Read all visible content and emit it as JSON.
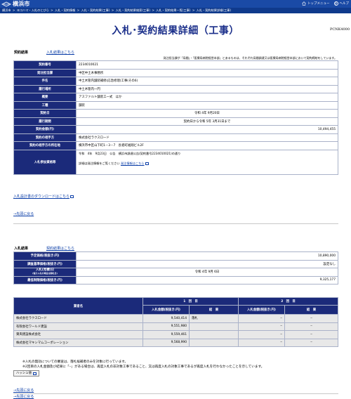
{
  "header": {
    "site_name": "横浜市",
    "top_menu_label": "トップメニュー",
    "help_label": "ヘルプ"
  },
  "breadcrumb": [
    "横浜市",
    "ヨコハマ・入札のとびら",
    "入札・契約情報",
    "入札・契約結果(工事)",
    "入札・契約結果検索(工事)",
    "入札・契約結果一覧(工事)",
    "入札・契約結果詳細(工事)"
  ],
  "page": {
    "title": "入札･契約結果詳細（工事）",
    "code": "PCNK4000"
  },
  "contract_section": {
    "heading": "契約結果",
    "link": "入札結果はこちら",
    "note": "発注担当課が「局間」・「医療局病院経営本部」とあるものは、それぞれ局間調達又は医療局病院経営本部において契約締結をしています。",
    "rows": [
      {
        "label": "契約番号",
        "value": "2234010021"
      },
      {
        "label": "発注担当課",
        "value": "中区中土木事務所"
      },
      {
        "label": "件名",
        "value": "中土木管内舗装補修(応急修理)工事(その6)"
      },
      {
        "label": "履行場所",
        "value": "中土木管内一円"
      },
      {
        "label": "概要",
        "value": "アスファルト舗装工一式　ほか"
      },
      {
        "label": "工種",
        "value": "舗装"
      },
      {
        "label": "契約日",
        "value": "令和 4年 9月20日"
      },
      {
        "label": "履行期間",
        "value": "契約日から令和 5年 3月31日まで"
      },
      {
        "label": "契約金額(円)",
        "value": "10,494,455"
      },
      {
        "label": "契約の相手方",
        "value": "株式会社ラクスロード"
      },
      {
        "label": "契約の相手方の所在地",
        "value": "横浜市中区山下町1－3－7　長者町福翔ビル2F"
      }
    ],
    "bid_participant": {
      "label": "入札参加資格等",
      "line1": "令和　4年　9月23日　公告　横浜市調達公告(契約番号2234010021)の通り",
      "line2": "詳細は発注情報をご覧ください",
      "line2_link": "発注情報はこちら"
    },
    "download_link": "入札設計書のダウンロードはこちら",
    "back_link": "→先頭に戻る"
  },
  "bid_section": {
    "heading": "入札結果",
    "link": "契約結果はこちら",
    "rows": [
      {
        "label": "予定価格(税抜き:円)",
        "value": "10,890,000"
      },
      {
        "label": "調査基準価格(税抜き:円)",
        "value": "設定なし"
      },
      {
        "label": "入札(見積)日",
        "label_sub": "(電子入札の場合は開札日)",
        "value": "令和 4年 9月 6日"
      },
      {
        "label": "最低制限価格(税抜き:円)",
        "value": "9,325,177"
      }
    ]
  },
  "results": {
    "bidder_header": "業者名",
    "round1": "1　回　目",
    "round2": "2　回　目",
    "amount_header": "入札金額(税抜き:円)",
    "result_header": "結　果",
    "rows": [
      {
        "name": "株式会社ラクスロード",
        "amount1": "9,540,414",
        "result1": "落札",
        "amount2": "‒",
        "result2": "‒"
      },
      {
        "name": "有限会社ワールド建設",
        "amount1": "9,551,980",
        "result1": "",
        "amount2": "‒",
        "result2": "‒"
      },
      {
        "name": "東央建設株式会社",
        "amount1": "9,559,461",
        "result1": "",
        "amount2": "‒",
        "result2": "‒"
      },
      {
        "name": "株式会社マキシマムコーポレーション",
        "amount1": "9,568,990",
        "result1": "",
        "amount2": "‒",
        "result2": "‒"
      }
    ],
    "note1": "※入札の無効についての審査は、落札候補者のみを対象に行っています。",
    "note2": "※2回目の入札金額及び結果に「‒」がある場合は、再度入札の非対象工事であること、又は再度入札の対象工事であるが再度入札を行わなかったことを示しています。",
    "hash_button": "ハッシュ値",
    "back_link": "→先頭に戻る",
    "back_link_bottom": "→先頭に戻る"
  },
  "colors": {
    "header_bg": "#1a4aa6",
    "label_bg": "#1b2a7a",
    "title": "#1a2e8a",
    "link": "#0b3ea8"
  }
}
